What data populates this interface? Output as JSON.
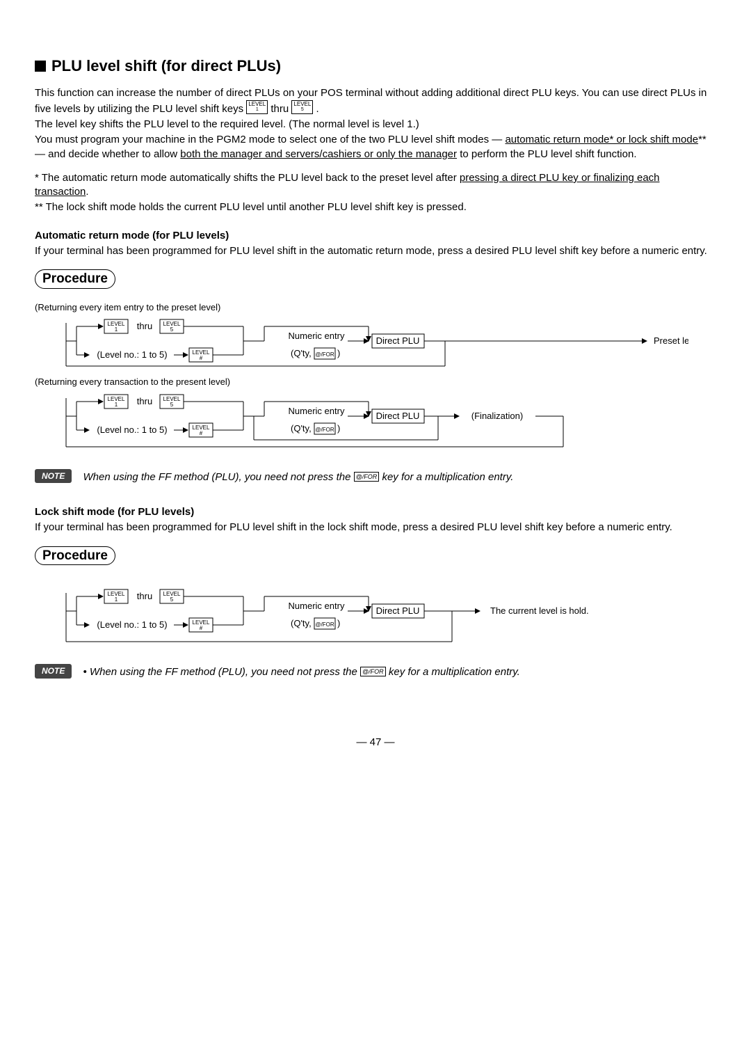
{
  "heading": "PLU level shift (for direct PLUs)",
  "intro1a": "This function can increase the number of direct PLUs on your POS terminal without adding additional direct PLU keys. You can use direct PLUs in five levels by utilizing the PLU level shift keys ",
  "intro1b": " thru ",
  "intro1c": " .",
  "intro2": "The level key shifts the PLU level to the required level. (The normal level is level 1.)",
  "intro3a": "You must program your machine in the PGM2 mode to select one of the two PLU level shift modes — ",
  "intro3u": "automatic return mode* or lock shift mode",
  "intro3b": "** — and decide whether to allow ",
  "intro3u2": "both the manager and servers/cashiers or only the manager",
  "intro3c": " to perform the PLU level shift function.",
  "star1a": "*   The automatic return mode automatically shifts the PLU level back to the preset level after ",
  "star1u": "pressing a direct PLU key or finalizing each transaction",
  "star1b": ".",
  "star2": "** The lock shift mode holds the current PLU level until another PLU level shift key is pressed.",
  "auto_head": "Automatic return mode (for PLU levels)",
  "auto_body": "If your terminal has been programmed for PLU level shift in the automatic return mode, press a desired PLU level shift key before a numeric entry.",
  "procedure": "Procedure",
  "dlabel1": "(Returning every item entry to the preset level)",
  "dlabel2": "(Returning every transaction to the present level)",
  "diag": {
    "thru": "thru",
    "levelno": "(Level no.: 1 to 5)",
    "numeric": "Numeric entry",
    "qty": "(Q'ty, ",
    "qtyend": ")",
    "direct": "Direct PLU",
    "preset": "Preset level",
    "finalization": "(Finalization)",
    "holdlevel": "The current level is hold.",
    "key_level1_top": "LEVEL",
    "key_level1_sub": "1",
    "key_level5_top": "LEVEL",
    "key_level5_sub": "5",
    "key_levelh_top": "LEVEL",
    "key_levelh_sub": "#",
    "key_for": "@/FOR"
  },
  "note": "NOTE",
  "note1a": "When using the FF method (PLU), you need not press the ",
  "note1b": " key for a multiplication entry.",
  "lock_head": "Lock shift mode (for PLU levels)",
  "lock_body": "If your terminal has been programmed for PLU level shift in the lock shift mode, press a desired PLU level shift key before a numeric entry.",
  "note2a": "• When using the FF method (PLU), you need not press the ",
  "note2b": " key for a multiplication entry.",
  "pagefoot": "— 47 —"
}
